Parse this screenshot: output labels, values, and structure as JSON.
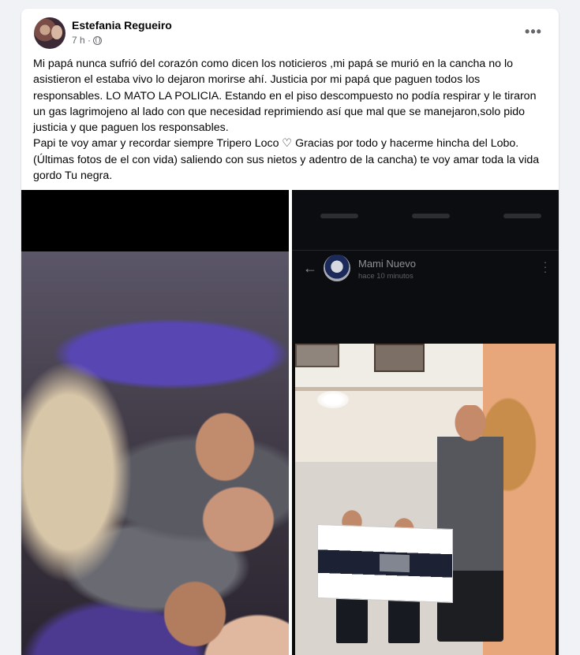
{
  "post": {
    "author": "Estefania Regueiro",
    "time": "7 h ·",
    "more_label": "•••",
    "paragraphs": [
      "Mi papá nunca sufrió del corazón como dicen los noticieros ,mi papá se murió en la cancha no lo asistieron el estaba vivo lo dejaron morirse ahí. Justicia por mi papá que paguen todos los responsables. LO MATO LA POLICIA. Estando en el piso descompuesto no podía respirar y le tiraron un gas lagrimojeno al lado con que necesidad reprimiendo así que mal que se manejaron,solo pido justicia y que paguen los responsables.",
      "Papi te voy amar y recordar siempre Tripero Loco ♡ Gracias por todo y hacerme hincha del Lobo.",
      "(Últimas fotos de el con vida) saliendo con sus nietos y adentro de la cancha) te voy amar toda la vida gordo Tu negra."
    ]
  },
  "photo_right": {
    "contact_name": "Mami Nuevo",
    "contact_sub": "hace 10 minutos"
  },
  "colors": {
    "background": "#f0f2f5",
    "card": "#ffffff",
    "text": "#050505",
    "muted": "#65676b"
  },
  "icons": {
    "globe": "globe-icon",
    "more": "more-icon",
    "back": "back-arrow-icon",
    "menu": "vertical-dots-icon"
  }
}
